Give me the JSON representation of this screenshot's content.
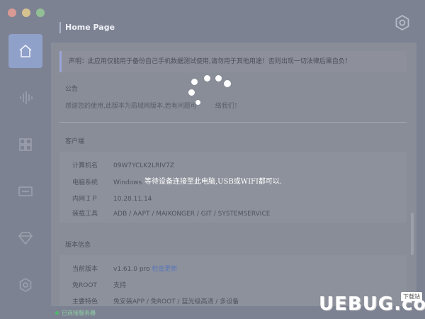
{
  "window": {
    "page_title": "Home Page"
  },
  "sidebar": {
    "items": [
      {
        "name": "home",
        "icon": "home-icon",
        "active": true
      },
      {
        "name": "sound",
        "icon": "sound-wave-icon",
        "active": false
      },
      {
        "name": "apps",
        "icon": "grid-icon",
        "active": false
      },
      {
        "name": "screen",
        "icon": "screen-icon",
        "active": false
      },
      {
        "name": "diamond",
        "icon": "diamond-icon",
        "active": false
      },
      {
        "name": "settings",
        "icon": "settings-icon",
        "active": false
      }
    ]
  },
  "notice": {
    "text": "声明：此应用仅能用于备份自己手机数据测试使用,请勿用于其他用途！否则出现一切法律后果自负！"
  },
  "announcement": {
    "title": "公告",
    "text_start": "感谢您的使用,此版本为局域网版本,若有问题可",
    "text_end": "络我们！"
  },
  "client": {
    "title": "客户端",
    "rows": [
      {
        "key": "计算机名",
        "value": "09W7YCLK2LRIV7Z"
      },
      {
        "key": "电脑系统",
        "value": "Windows"
      },
      {
        "key": "内网ＩＰ",
        "value": "10.28.11.14"
      },
      {
        "key": "装载工具",
        "value": "ADB / AAPT / MAIKONGER / GIT / SYSTEMSERVICE"
      }
    ]
  },
  "version": {
    "title": "版本信息",
    "rows": [
      {
        "key": "当前版本",
        "value": "v1.61.0 pro",
        "link": "检查更新"
      },
      {
        "key": "免ROOT",
        "value": "支持"
      },
      {
        "key": "主要特色",
        "value": "免安装APP / 免ROOT / 蓝光级高清 / 多设备"
      }
    ]
  },
  "status": {
    "text": "已连接服务器"
  },
  "overlay": {
    "message": "等待设备连接至此电脑,USB或WIFI都可以."
  },
  "watermark": {
    "main": "UEBUG.com",
    "sub": "下载站"
  },
  "colors": {
    "overlay": "#7d8293",
    "active_sidebar": "#8fa0c9",
    "status_green": "#4fb86b"
  }
}
